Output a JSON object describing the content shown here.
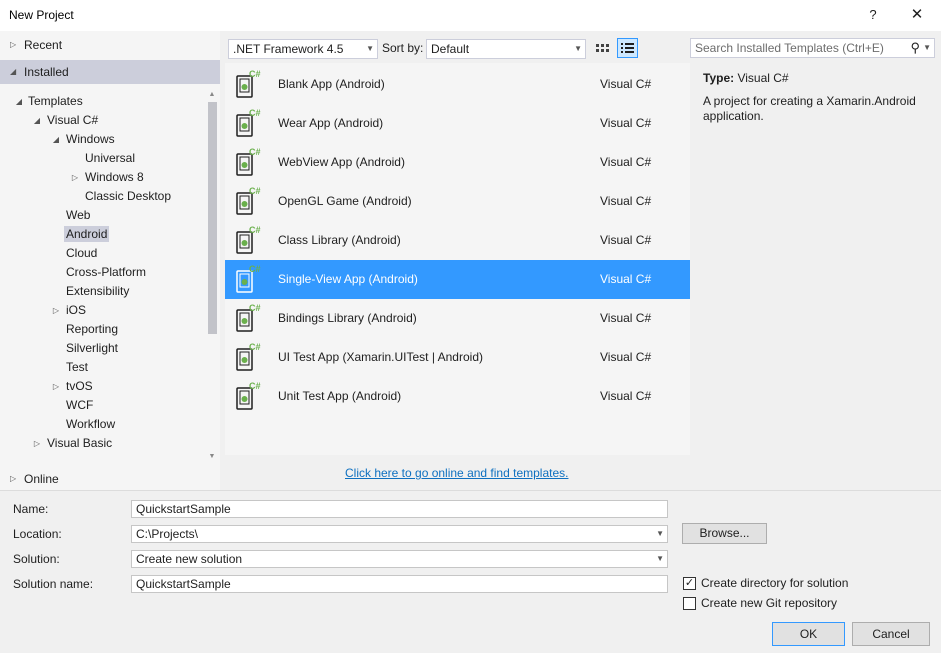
{
  "window": {
    "title": "New Project",
    "help": "?",
    "close": "✕"
  },
  "nav": {
    "recent": "Recent",
    "installed": "Installed",
    "online": "Online"
  },
  "tree": {
    "templates": "Templates",
    "visual_csharp": "Visual C#",
    "windows": "Windows",
    "universal": "Universal",
    "windows8": "Windows 8",
    "classic_desktop": "Classic Desktop",
    "web": "Web",
    "android": "Android",
    "cloud": "Cloud",
    "cross_platform": "Cross-Platform",
    "extensibility": "Extensibility",
    "ios": "iOS",
    "reporting": "Reporting",
    "silverlight": "Silverlight",
    "test": "Test",
    "tvos": "tvOS",
    "wcf": "WCF",
    "workflow": "Workflow",
    "visual_basic": "Visual Basic"
  },
  "toolbar": {
    "framework": ".NET Framework 4.5",
    "sort_label": "Sort by:",
    "sort_value": "Default",
    "search_placeholder": "Search Installed Templates (Ctrl+E)"
  },
  "templates": [
    {
      "name": "Blank App (Android)",
      "lang": "Visual C#",
      "icon": "android-blank-app-icon"
    },
    {
      "name": "Wear App (Android)",
      "lang": "Visual C#",
      "icon": "android-wear-app-icon"
    },
    {
      "name": "WebView App (Android)",
      "lang": "Visual C#",
      "icon": "android-webview-app-icon"
    },
    {
      "name": "OpenGL Game (Android)",
      "lang": "Visual C#",
      "icon": "android-opengl-game-icon"
    },
    {
      "name": "Class Library (Android)",
      "lang": "Visual C#",
      "icon": "android-class-library-icon"
    },
    {
      "name": "Single-View App (Android)",
      "lang": "Visual C#",
      "icon": "android-single-view-app-icon",
      "selected": true
    },
    {
      "name": "Bindings Library (Android)",
      "lang": "Visual C#",
      "icon": "android-bindings-library-icon"
    },
    {
      "name": "UI Test App (Xamarin.UITest | Android)",
      "lang": "Visual C#",
      "icon": "android-ui-test-app-icon"
    },
    {
      "name": "Unit Test App (Android)",
      "lang": "Visual C#",
      "icon": "android-unit-test-app-icon"
    }
  ],
  "online_link": "Click here to go online and find templates.",
  "description": {
    "type_label": "Type:",
    "type_value": "Visual C#",
    "text": "A project for creating a Xamarin.Android application."
  },
  "form": {
    "name_label": "Name:",
    "name_value": "QuickstartSample",
    "location_label": "Location:",
    "location_value": "C:\\Projects\\",
    "solution_label": "Solution:",
    "solution_value": "Create new solution",
    "solution_name_label": "Solution name:",
    "solution_name_value": "QuickstartSample",
    "browse": "Browse...",
    "create_dir_label": "Create directory for solution",
    "create_dir_checked": true,
    "git_label": "Create new Git repository",
    "git_checked": false,
    "ok": "OK",
    "cancel": "Cancel"
  },
  "colors": {
    "selection": "#3399ff",
    "android_green": "#6ab04c",
    "link": "#0e70c0"
  }
}
